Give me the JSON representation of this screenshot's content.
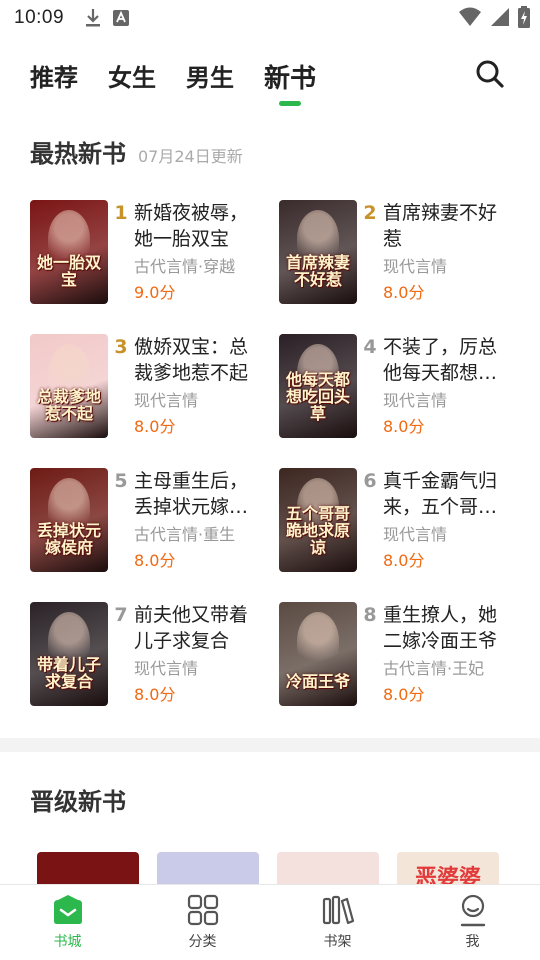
{
  "status_bar": {
    "time": "10:09"
  },
  "top_tabs": [
    {
      "label": "推荐",
      "active": false
    },
    {
      "label": "女生",
      "active": false
    },
    {
      "label": "男生",
      "active": false
    },
    {
      "label": "新书",
      "active": true
    }
  ],
  "hot_section": {
    "title": "最热新书",
    "update_text": "07月24日更新"
  },
  "books": [
    {
      "rank": "1",
      "title": "新婚夜被辱，她一胎双宝",
      "genre": "古代言情·穿越",
      "score": "9.0分",
      "cover_text": "她一胎双宝",
      "cover_bg": "#7a1414"
    },
    {
      "rank": "2",
      "title": "首席辣妻不好惹",
      "genre": "现代言情",
      "score": "8.0分",
      "cover_text": "首席辣妻不好惹",
      "cover_bg": "#3a2b2b"
    },
    {
      "rank": "3",
      "title": "傲娇双宝：总裁爹地惹不起",
      "genre": "现代言情",
      "score": "8.0分",
      "cover_text": "总裁爹地惹不起",
      "cover_bg": "#f2c9c9"
    },
    {
      "rank": "4",
      "title": "不装了，厉总他每天都想吃回头草",
      "genre": "现代言情",
      "score": "8.0分",
      "cover_text": "他每天都想吃回头草",
      "cover_bg": "#2a1f24"
    },
    {
      "rank": "5",
      "title": "主母重生后，丢掉状元嫁侯府",
      "genre": "古代言情·重生",
      "score": "8.0分",
      "cover_text": "丢掉状元嫁侯府",
      "cover_bg": "#6e1a14"
    },
    {
      "rank": "6",
      "title": "真千金霸气归来，五个哥哥跪地求原谅",
      "genre": "现代言情",
      "score": "8.0分",
      "cover_text": "五个哥哥跪地求原谅",
      "cover_bg": "#3c2620"
    },
    {
      "rank": "7",
      "title": "前夫他又带着儿子求复合",
      "genre": "现代言情",
      "score": "8.0分",
      "cover_text": "带着儿子求复合",
      "cover_bg": "#2a2226"
    },
    {
      "rank": "8",
      "title": "重生撩人，她二嫁冷面王爷",
      "genre": "古代言情·王妃",
      "score": "8.0分",
      "cover_text": "冷面王爷",
      "cover_bg": "#5a4a42"
    }
  ],
  "promo_section": {
    "title": "晋级新书",
    "covers": [
      {
        "bg": "#7a1414",
        "text": ""
      },
      {
        "bg": "#c9cbe8",
        "text": ""
      },
      {
        "bg": "#f4e0dc",
        "text": ""
      },
      {
        "bg": "#f3e6d8",
        "text": "恶婆婆"
      }
    ]
  },
  "bottom_nav": [
    {
      "label": "书城",
      "icon": "bookstore-icon",
      "active": true
    },
    {
      "label": "分类",
      "icon": "category-icon",
      "active": false
    },
    {
      "label": "书架",
      "icon": "bookshelf-icon",
      "active": false
    },
    {
      "label": "我",
      "icon": "profile-icon",
      "active": false
    }
  ],
  "colors": {
    "accent": "#2db84d",
    "score": "#f06a14",
    "rank_top": "#c8922a",
    "rank_other": "#999999"
  }
}
